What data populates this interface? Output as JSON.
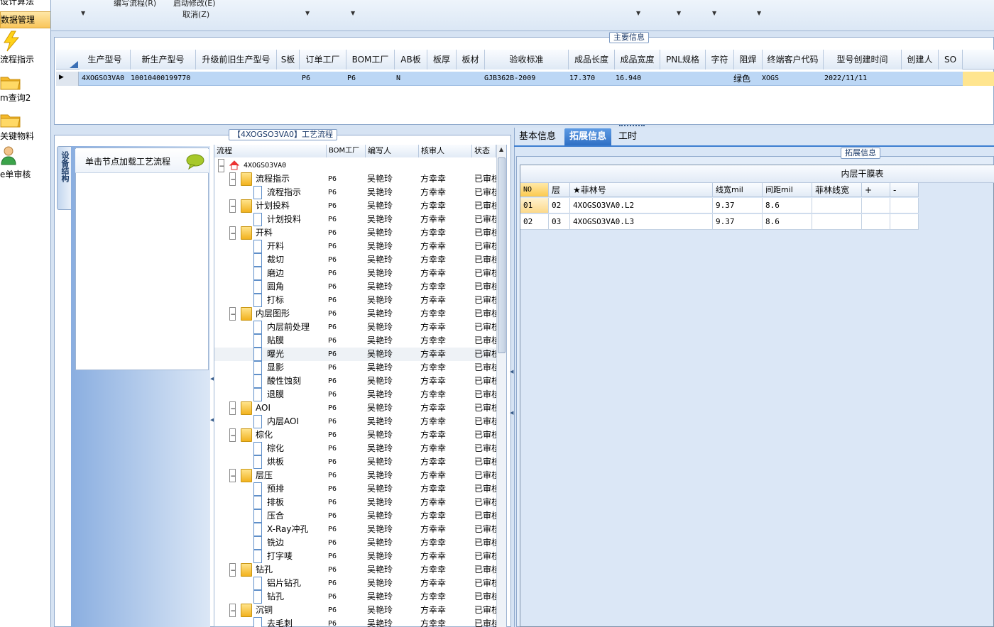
{
  "nav": {
    "top_items": [
      "设计算法",
      "数据管理"
    ],
    "items": [
      "流程指示",
      "m查询2",
      "关键物料",
      "e单审核"
    ]
  },
  "toolbar": {
    "menu1": "编写流程(R)",
    "menu2": "启动修改(E)",
    "menu3": "取消(Z)"
  },
  "main_info": {
    "title": "主要信息",
    "columns": [
      "生产型号",
      "新生产型号",
      "升级前旧生产型号",
      "S板",
      "订单工厂",
      "BOM工厂",
      "AB板",
      "板厚",
      "板材",
      "验收标准",
      "成品长度",
      "成品宽度",
      "PNL规格",
      "字符",
      "阻焊",
      "终端客户代码",
      "型号创建时间",
      "创建人",
      "SO"
    ],
    "row": {
      "prod_model": "4XOGSO3VA0",
      "new_model": "10010400199770",
      "old_model": "",
      "s_board": "",
      "order_factory": "P6",
      "bom_factory": "P6",
      "ab_board": "N",
      "thickness": "",
      "material": "",
      "standard": "GJB362B-2009",
      "length": "17.370",
      "width": "16.940",
      "pnl": "",
      "char": "",
      "solder": "绿色",
      "client_code": "XOGS",
      "created": "2022/11/11",
      "creator": "",
      "so": ""
    }
  },
  "flow_panel": {
    "title": "【4XOGSO3VA0】工艺流程",
    "side_tab": "设备结构",
    "hint": "单击节点加载工艺流程",
    "columns": [
      "流程",
      "BOM工厂",
      "编写人",
      "核审人",
      "状态"
    ],
    "root": "4XOGSO3VA0",
    "rows": [
      {
        "name": "流程指示",
        "level": 1,
        "bom": "P6",
        "writer": "吴艳玲",
        "reviewer": "方幸幸",
        "status": "已审核"
      },
      {
        "name": "流程指示",
        "level": 2,
        "bom": "P6",
        "writer": "吴艳玲",
        "reviewer": "方幸幸",
        "status": "已审核"
      },
      {
        "name": "计划投料",
        "level": 1,
        "bom": "P6",
        "writer": "吴艳玲",
        "reviewer": "方幸幸",
        "status": "已审核"
      },
      {
        "name": "计划投料",
        "level": 2,
        "bom": "P6",
        "writer": "吴艳玲",
        "reviewer": "方幸幸",
        "status": "已审核"
      },
      {
        "name": "开料",
        "level": 1,
        "bom": "P6",
        "writer": "吴艳玲",
        "reviewer": "方幸幸",
        "status": "已审核"
      },
      {
        "name": "开料",
        "level": 2,
        "bom": "P6",
        "writer": "吴艳玲",
        "reviewer": "方幸幸",
        "status": "已审核"
      },
      {
        "name": "裁切",
        "level": 2,
        "bom": "P6",
        "writer": "吴艳玲",
        "reviewer": "方幸幸",
        "status": "已审核"
      },
      {
        "name": "磨边",
        "level": 2,
        "bom": "P6",
        "writer": "吴艳玲",
        "reviewer": "方幸幸",
        "status": "已审核"
      },
      {
        "name": "圆角",
        "level": 2,
        "bom": "P6",
        "writer": "吴艳玲",
        "reviewer": "方幸幸",
        "status": "已审核"
      },
      {
        "name": "打标",
        "level": 2,
        "bom": "P6",
        "writer": "吴艳玲",
        "reviewer": "方幸幸",
        "status": "已审核"
      },
      {
        "name": "内层图形",
        "level": 1,
        "bom": "P6",
        "writer": "吴艳玲",
        "reviewer": "方幸幸",
        "status": "已审核"
      },
      {
        "name": "内层前处理",
        "level": 2,
        "bom": "P6",
        "writer": "吴艳玲",
        "reviewer": "方幸幸",
        "status": "已审核"
      },
      {
        "name": "贴膜",
        "level": 2,
        "bom": "P6",
        "writer": "吴艳玲",
        "reviewer": "方幸幸",
        "status": "已审核"
      },
      {
        "name": "曝光",
        "level": 2,
        "bom": "P6",
        "writer": "吴艳玲",
        "reviewer": "方幸幸",
        "status": "已审核"
      },
      {
        "name": "显影",
        "level": 2,
        "bom": "P6",
        "writer": "吴艳玲",
        "reviewer": "方幸幸",
        "status": "已审核"
      },
      {
        "name": "酸性蚀刻",
        "level": 2,
        "bom": "P6",
        "writer": "吴艳玲",
        "reviewer": "方幸幸",
        "status": "已审核"
      },
      {
        "name": "退膜",
        "level": 2,
        "bom": "P6",
        "writer": "吴艳玲",
        "reviewer": "方幸幸",
        "status": "已审核"
      },
      {
        "name": "AOI",
        "level": 1,
        "bom": "P6",
        "writer": "吴艳玲",
        "reviewer": "方幸幸",
        "status": "已审核"
      },
      {
        "name": "内层AOI",
        "level": 2,
        "bom": "P6",
        "writer": "吴艳玲",
        "reviewer": "方幸幸",
        "status": "已审核"
      },
      {
        "name": "棕化",
        "level": 1,
        "bom": "P6",
        "writer": "吴艳玲",
        "reviewer": "方幸幸",
        "status": "已审核"
      },
      {
        "name": "棕化",
        "level": 2,
        "bom": "P6",
        "writer": "吴艳玲",
        "reviewer": "方幸幸",
        "status": "已审核"
      },
      {
        "name": "烘板",
        "level": 2,
        "bom": "P6",
        "writer": "吴艳玲",
        "reviewer": "方幸幸",
        "status": "已审核"
      },
      {
        "name": "层压",
        "level": 1,
        "bom": "P6",
        "writer": "吴艳玲",
        "reviewer": "方幸幸",
        "status": "已审核"
      },
      {
        "name": "预排",
        "level": 2,
        "bom": "P6",
        "writer": "吴艳玲",
        "reviewer": "方幸幸",
        "status": "已审核"
      },
      {
        "name": "排板",
        "level": 2,
        "bom": "P6",
        "writer": "吴艳玲",
        "reviewer": "方幸幸",
        "status": "已审核"
      },
      {
        "name": "压合",
        "level": 2,
        "bom": "P6",
        "writer": "吴艳玲",
        "reviewer": "方幸幸",
        "status": "已审核"
      },
      {
        "name": "X-Ray冲孔",
        "level": 2,
        "bom": "P6",
        "writer": "吴艳玲",
        "reviewer": "方幸幸",
        "status": "已审核"
      },
      {
        "name": "铣边",
        "level": 2,
        "bom": "P6",
        "writer": "吴艳玲",
        "reviewer": "方幸幸",
        "status": "已审核"
      },
      {
        "name": "打字唛",
        "level": 2,
        "bom": "P6",
        "writer": "吴艳玲",
        "reviewer": "方幸幸",
        "status": "已审核"
      },
      {
        "name": "钻孔",
        "level": 1,
        "bom": "P6",
        "writer": "吴艳玲",
        "reviewer": "方幸幸",
        "status": "已审核"
      },
      {
        "name": "铝片钻孔",
        "level": 2,
        "bom": "P6",
        "writer": "吴艳玲",
        "reviewer": "方幸幸",
        "status": "已审核"
      },
      {
        "name": "钻孔",
        "level": 2,
        "bom": "P6",
        "writer": "吴艳玲",
        "reviewer": "方幸幸",
        "status": "已审核"
      },
      {
        "name": "沉铜",
        "level": 1,
        "bom": "P6",
        "writer": "吴艳玲",
        "reviewer": "方幸幸",
        "status": "已审核"
      },
      {
        "name": "去毛刺",
        "level": 2,
        "bom": "P6",
        "writer": "吴艳玲",
        "reviewer": "方幸幸",
        "status": "已审核"
      }
    ]
  },
  "right_panel": {
    "tabs": [
      "基本信息",
      "拓展信息",
      "工时"
    ],
    "group_title": "拓展信息",
    "table_title": "内层干膜表",
    "columns": [
      "NO",
      "层",
      "★菲林号",
      "线宽mil",
      "间距mil",
      "菲林线宽",
      "+",
      "-"
    ],
    "rows": [
      [
        "01",
        "02",
        "4XOGSO3VA0.L2",
        "9.37",
        "8.6",
        "",
        "",
        ""
      ],
      [
        "02",
        "03",
        "4XOGSO3VA0.L3",
        "9.37",
        "8.6",
        "",
        "",
        ""
      ]
    ]
  },
  "colors": {
    "selection": "#bcd7f5",
    "panel_bg": "#d9e6f6",
    "header_tab_active": "#3d7ed0"
  }
}
